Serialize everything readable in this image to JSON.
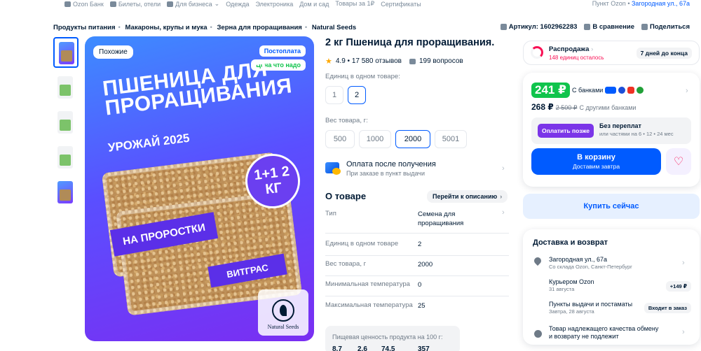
{
  "topnav": {
    "links": [
      "Ozon Банк",
      "Билеты, отели",
      "Для бизнеса",
      "Одежда",
      "Электроника",
      "Дом и сад",
      "Товары за 1₽",
      "Сертификаты"
    ],
    "pickup_label": "Пункт Ozon • ",
    "pickup_address": "Загородная ул., 67а"
  },
  "breadcrumbs": [
    "Продукты питания",
    "Макароны, крупы и мука",
    "Зерна для проращивания",
    "Natural Seeds"
  ],
  "article": "Артикул: 1602962283",
  "compare": "В сравнение",
  "share": "Поделиться",
  "image": {
    "similar": "Похожие",
    "postpay": "Постоплата",
    "fair_price": "Цена что надо",
    "headline": "ПШЕНИЦА ДЛЯ ПРОРАЩИВАНИЯ",
    "harvest": "УРОЖАЙ 2025",
    "promo": "1+1 2 КГ",
    "sprouts": "НА ПРОРОСТКИ",
    "wheatgrass": "ВИТГРАС",
    "brand": "Natural Seeds"
  },
  "product": {
    "title": "2 кг Пшеница для проращивания.",
    "rating": "4.9 • 17 580 отзывов",
    "questions": "199 вопросов",
    "units_label": "Единиц в одном товаре:",
    "units": [
      "1",
      "2"
    ],
    "weight_label": "Вес товара, г:",
    "weights": [
      "500",
      "1000",
      "2000",
      "5001"
    ],
    "pay_title": "Оплата после получения",
    "pay_sub": "При заказе в пункт выдачи",
    "about": "О товаре",
    "goto_desc": "Перейти к описанию",
    "specs": [
      {
        "k": "Тип",
        "v": "Семена для проращивания"
      },
      {
        "k": "Единиц в одном товаре",
        "v": "2"
      },
      {
        "k": "Вес товара, г",
        "v": "2000"
      },
      {
        "k": "Минимальная температура",
        "v": "0"
      },
      {
        "k": "Максимальная температура",
        "v": "25"
      }
    ],
    "nutrition_title": "Пищевая ценность продукта на 100 г:",
    "nutrition": [
      "8.7",
      "2.6",
      "74.5",
      "357"
    ]
  },
  "right": {
    "sale_title": "Распродажа",
    "sale_sub": "148 единиц осталось",
    "sale_days": "7 дней до конца",
    "price_bank": "241 ₽",
    "price_bank_label": "С банками",
    "price_other": "268 ₽",
    "price_old": "2 500 ₽",
    "price_other_label": "С другими банками",
    "bnpl_button": "Оплатить позже",
    "bnpl_title": "Без переплат",
    "bnpl_sub": "или частями на 6 • 12 • 24 мес",
    "cart_title": "В корзину",
    "cart_sub": "Доставим завтра",
    "buy_now": "Купить сейчас",
    "delivery_title": "Доставка и возврат",
    "addr_title": "Загородная ул., 67а",
    "addr_sub": "Со склада Ozon, Санкт-Петербург",
    "courier_title": "Курьером Ozon",
    "courier_sub": "31 августа",
    "courier_price": "+149 ₽",
    "points_title": "Пункты выдачи и постаматы",
    "points_sub": "Завтра, 28 августа",
    "points_pill": "Входит в заказ",
    "return_title": "Товар надлежащего качества обмену",
    "return_sub": "и возврату не подлежит"
  },
  "colors": {
    "accent": "#005bff",
    "green": "#10c44c",
    "pink": "#f91155",
    "purple": "#7b35e8"
  }
}
